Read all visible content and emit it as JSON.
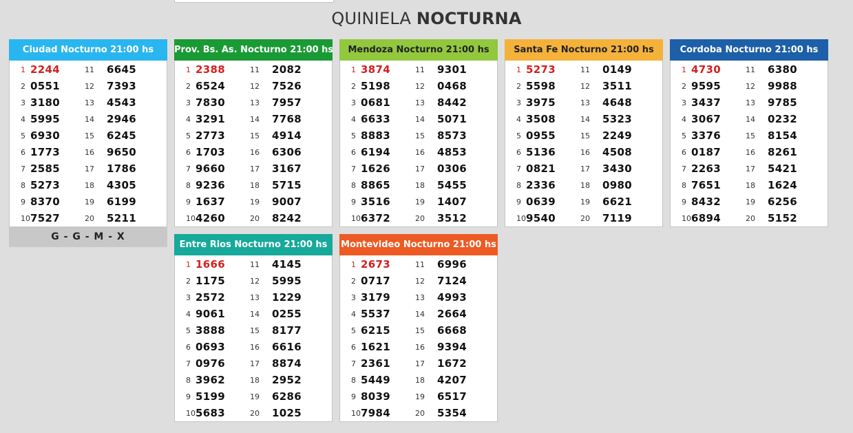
{
  "title": {
    "light": "QUINIELA",
    "bold": "NOCTURNA"
  },
  "footer": "G - G - M - X",
  "cards": [
    {
      "id": "ciudad",
      "title": "Ciudad Nocturno 21:00 hs",
      "color": "#29b6f0",
      "dark_text": false,
      "numbers": [
        "2244",
        "0551",
        "3180",
        "5995",
        "6930",
        "1773",
        "2585",
        "5273",
        "8370",
        "7527",
        "6645",
        "7393",
        "4543",
        "2946",
        "6245",
        "9650",
        "1786",
        "4305",
        "6199",
        "5211"
      ]
    },
    {
      "id": "provincia",
      "title": "Prov. Bs. As. Nocturno 21:00 hs",
      "color": "#1a9a34",
      "dark_text": false,
      "numbers": [
        "2388",
        "6524",
        "7830",
        "3291",
        "2773",
        "1703",
        "9660",
        "9236",
        "1637",
        "4260",
        "2082",
        "7526",
        "7957",
        "7768",
        "4914",
        "6306",
        "3167",
        "5715",
        "9007",
        "8242"
      ]
    },
    {
      "id": "mendoza",
      "title": "Mendoza Nocturno 21:00 hs",
      "color": "#92c83e",
      "dark_text": true,
      "numbers": [
        "3874",
        "5198",
        "0681",
        "6633",
        "8883",
        "6194",
        "1626",
        "8865",
        "3516",
        "6372",
        "9301",
        "0468",
        "8442",
        "5071",
        "8573",
        "4853",
        "0306",
        "5455",
        "1407",
        "3512"
      ]
    },
    {
      "id": "santafe",
      "title": "Santa Fe Nocturno 21:00 hs",
      "color": "#f5b23a",
      "dark_text": true,
      "numbers": [
        "5273",
        "5598",
        "3975",
        "3508",
        "0955",
        "5136",
        "0821",
        "2336",
        "0639",
        "9540",
        "0149",
        "3511",
        "4648",
        "5323",
        "2249",
        "4508",
        "3430",
        "0980",
        "6621",
        "7119"
      ]
    },
    {
      "id": "cordoba",
      "title": "Cordoba Nocturno 21:00 hs",
      "color": "#1d5fa8",
      "dark_text": false,
      "numbers": [
        "4730",
        "9595",
        "3437",
        "3067",
        "3376",
        "0187",
        "2263",
        "7651",
        "8432",
        "6894",
        "6380",
        "9988",
        "9785",
        "0232",
        "8154",
        "8261",
        "5421",
        "1624",
        "6256",
        "5152"
      ]
    },
    {
      "id": "entrerios",
      "title": "Entre Rios Nocturno 21:00 hs",
      "color": "#17a99a",
      "dark_text": false,
      "numbers": [
        "1666",
        "1175",
        "2572",
        "9061",
        "3888",
        "0693",
        "0976",
        "3962",
        "5199",
        "5683",
        "4145",
        "5995",
        "1229",
        "0255",
        "8177",
        "6616",
        "8874",
        "2952",
        "6286",
        "1025"
      ]
    },
    {
      "id": "montevideo",
      "title": "Montevideo Nocturno 21:00 hs",
      "color": "#ee5a24",
      "dark_text": false,
      "numbers": [
        "2673",
        "0717",
        "3179",
        "5537",
        "6215",
        "1621",
        "2361",
        "5449",
        "8039",
        "7984",
        "6996",
        "7124",
        "4993",
        "2664",
        "6668",
        "9394",
        "1672",
        "4207",
        "6517",
        "5354"
      ]
    }
  ]
}
